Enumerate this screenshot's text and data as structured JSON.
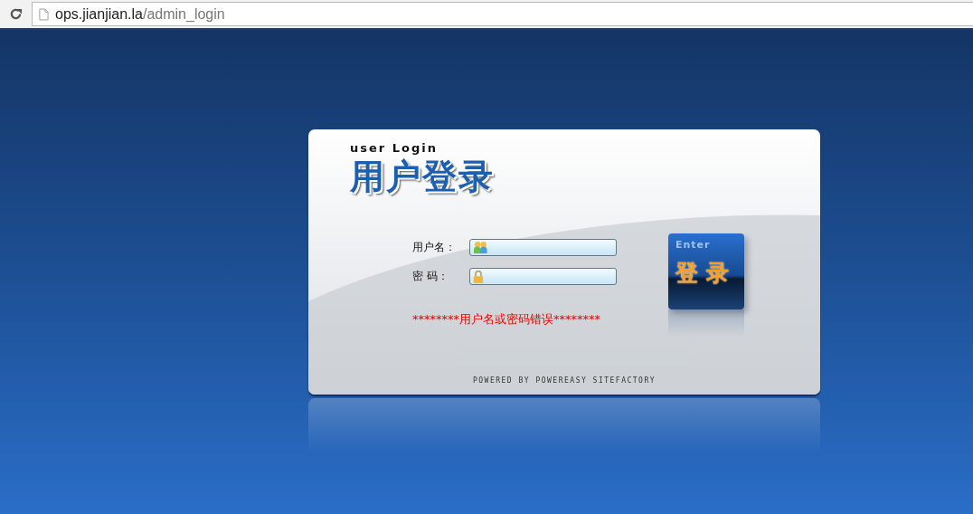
{
  "browser": {
    "url_host": "ops.jianjian.la",
    "url_path": "/admin_login"
  },
  "login": {
    "subtitle": "user Login",
    "title": "用户登录",
    "fields": [
      {
        "kind": "user",
        "label": "用户名："
      },
      {
        "kind": "password",
        "label": "密 码："
      }
    ],
    "error": "********用户名或密码错误********",
    "enter_button": {
      "caption": "Enter",
      "label": "登 录"
    },
    "footer": "POWERED BY POWEREASY SITEFACTORY"
  }
}
